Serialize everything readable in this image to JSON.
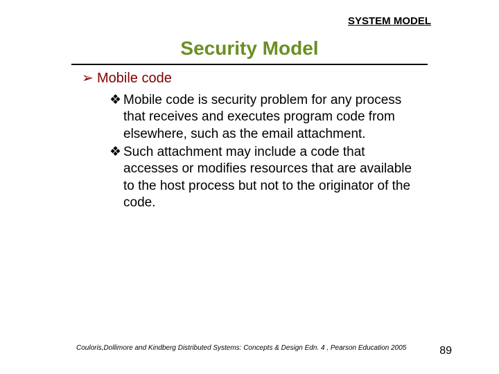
{
  "header": {
    "label": "SYSTEM MODEL"
  },
  "title": "Security Model",
  "outline": {
    "level1": {
      "bullet": "➢",
      "text": "Mobile code"
    },
    "level2": [
      {
        "bullet": "❖",
        "text": "Mobile code is security problem for any process that receives and executes program code from elsewhere, such as the email attachment."
      },
      {
        "bullet": "❖",
        "text": "Such attachment may include a code that accesses or modifies resources that are available to the host process but not to the originator of the code."
      }
    ]
  },
  "footer": {
    "citation": "Couloris,Dollimore and Kindberg  Distributed Systems: Concepts & Design  Edn. 4 , Pearson Education 2005",
    "page": "89"
  }
}
